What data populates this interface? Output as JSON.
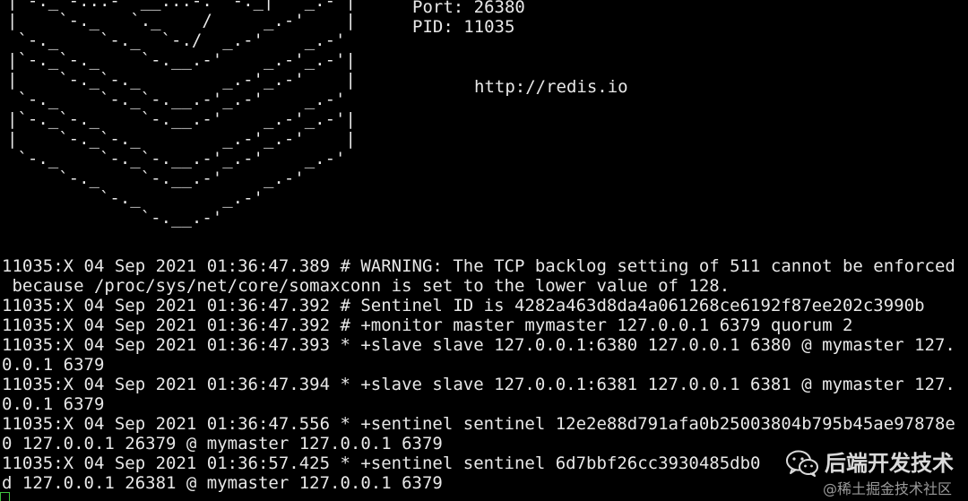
{
  "banner": {
    "logo_art": "|`-._`-...-` __...-.``-._|'` _.-'|\n|    `-._   `._    /     _.-'    |\n `-._    `-._  `-./  _.-'    _.-'\n|`-._`-._    `-.__.-'    _.-'_.-'|\n|    `-._`-._        _.-'_.-'    |\n `-._    `-._`-.__.-'_.-'    _.-'\n|`-._`-._    `-.__.-'    _.-'_.-'|\n|    `-._`-._        _.-'_.-'    |\n `-._    `-._`-.__.-'_.-'    _.-'\n     `-._    `-.__.-'    _.-'\n         `-._        _.-'\n             `-.__.-'",
    "port": "Port: 26380",
    "pid": "PID: 11035",
    "url": "http://redis.io"
  },
  "log_lines": [
    "11035:X 04 Sep 2021 01:36:47.389 # WARNING: The TCP backlog setting of 511 cannot be enforced",
    " because /proc/sys/net/core/somaxconn is set to the lower value of 128.",
    "11035:X 04 Sep 2021 01:36:47.392 # Sentinel ID is 4282a463d8da4a061268ce6192f87ee202c3990b",
    "11035:X 04 Sep 2021 01:36:47.392 # +monitor master mymaster 127.0.0.1 6379 quorum 2",
    "11035:X 04 Sep 2021 01:36:47.393 * +slave slave 127.0.0.1:6380 127.0.0.1 6380 @ mymaster 127.",
    "0.0.1 6379",
    "11035:X 04 Sep 2021 01:36:47.394 * +slave slave 127.0.0.1:6381 127.0.0.1 6381 @ mymaster 127.",
    "0.0.1 6379",
    "11035:X 04 Sep 2021 01:36:47.556 * +sentinel sentinel 12e2e88d791afa0b25003804b795b45ae97878e",
    "0 127.0.0.1 26379 @ mymaster 127.0.0.1 6379",
    "11035:X 04 Sep 2021 01:36:57.425 * +sentinel sentinel 6d7bbf26cc3930485db0",
    "d 127.0.0.1 26381 @ mymaster 127.0.0.1 6379"
  ],
  "watermark": {
    "icon": "wechat-icon",
    "title": "后端开发技术",
    "subtitle": "@稀土掘金技术社区"
  },
  "colors": {
    "background": "#000000",
    "text": "#e8e8e8",
    "cursor": "#3fc23f"
  }
}
